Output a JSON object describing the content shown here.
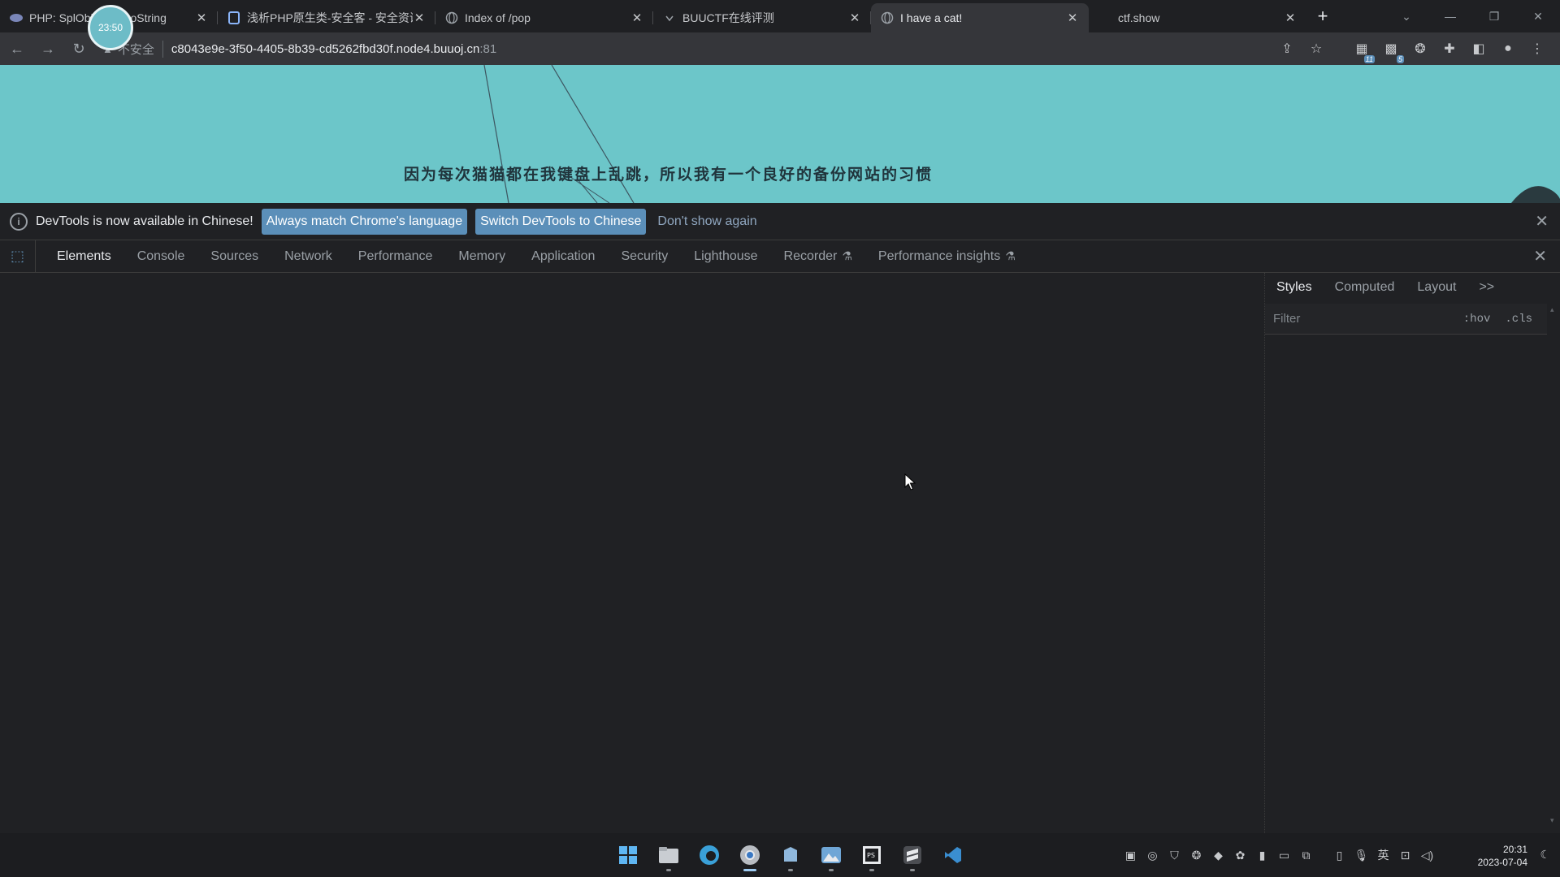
{
  "browser": {
    "tabs": [
      {
        "title": "PHP: SplObject::__toString",
        "favicon": "php-icon",
        "active": false
      },
      {
        "title": "浅析PHP原生类-安全客 - 安全资讯",
        "favicon": "doc-icon",
        "active": false
      },
      {
        "title": "Index of /pop",
        "favicon": "globe-icon",
        "active": false
      },
      {
        "title": "BUUCTF在线评测",
        "favicon": "buu-icon",
        "active": false
      },
      {
        "title": "I have a cat!",
        "favicon": "globe-icon",
        "active": true
      },
      {
        "title": "ctf.show",
        "favicon": "",
        "active": false
      }
    ],
    "timer_text": "23:50",
    "address": {
      "security_label": "不安全",
      "host": "c8043e9e-3f50-4405-8b39-cd5262fbd30f.node4.buuoj.cn",
      "port": ":81"
    },
    "extension_badges": [
      "11",
      "5"
    ]
  },
  "page": {
    "text": "因为每次猫猫都在我键盘上乱跳，所以我有一个良好的备份网站的习惯"
  },
  "devtools": {
    "infobar": {
      "message": "DevTools is now available in Chinese!",
      "button_match": "Always match Chrome's language",
      "button_switch": "Switch DevTools to Chinese",
      "link_dismiss": "Don't show again"
    },
    "tabs": [
      "Elements",
      "Console",
      "Sources",
      "Network",
      "Performance",
      "Memory",
      "Application",
      "Security",
      "Lighthouse",
      "Recorder",
      "Performance insights"
    ],
    "selected_tab": "Elements",
    "styles_pane": {
      "tabs": [
        "Styles",
        "Computed",
        "Layout"
      ],
      "more": ">>",
      "filter_placeholder": "Filter",
      "hov": ":hov",
      "cls": ".cls"
    }
  },
  "taskbar": {
    "apps": [
      "start-icon",
      "file-explorer-icon",
      "edge-icon",
      "chrome-icon",
      "app-icon",
      "photos-icon",
      "phpstorm-icon",
      "sublime-icon",
      "vscode-icon"
    ],
    "ime_label": "英",
    "time": "20:31",
    "date": "2023-07-04"
  },
  "colors": {
    "page_background": "#6cc6c9",
    "devtools_background": "#202124",
    "button_accent": "#5b8fb9"
  }
}
